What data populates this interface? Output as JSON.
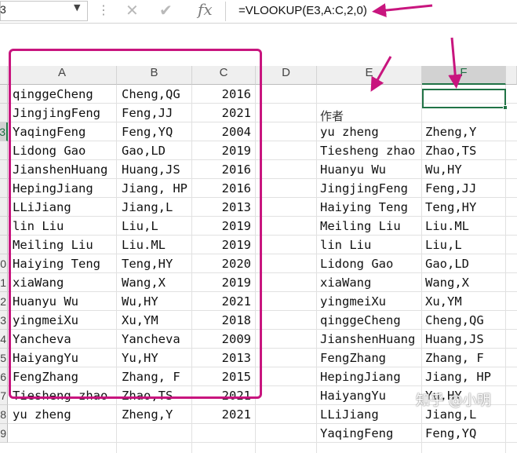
{
  "formula_bar": {
    "name_box": "3",
    "cancel_glyph": "✕",
    "enter_glyph": "✔",
    "fx_label": "fx",
    "formula": "=VLOOKUP(E3,A:C,2,0)"
  },
  "columns": [
    "A",
    "B",
    "C",
    "D",
    "E",
    "F"
  ],
  "selected_column": "F",
  "row_numbers": [
    "",
    "",
    "3",
    "",
    "",
    "",
    "",
    "",
    "",
    "0",
    "1",
    "2",
    "3",
    "4",
    "5",
    "6",
    "7",
    "8",
    "9"
  ],
  "selected_row": "3",
  "table_abc": [
    [
      "qinggeCheng",
      "Cheng,QG",
      "2016"
    ],
    [
      "JingjingFeng",
      "Feng,JJ",
      "2021"
    ],
    [
      "YaqingFeng",
      "Feng,YQ",
      "2004"
    ],
    [
      "Lidong Gao",
      "Gao,LD",
      "2019"
    ],
    [
      "JianshenHuang",
      "Huang,JS",
      "2016"
    ],
    [
      "HepingJiang",
      "Jiang, HP",
      "2016"
    ],
    [
      "LLiJiang",
      "Jiang,L",
      "2013"
    ],
    [
      "lin Liu",
      "Liu,L",
      "2019"
    ],
    [
      "Meiling Liu",
      "Liu.ML",
      "2019"
    ],
    [
      "Haiying Teng",
      "Teng,HY",
      "2020"
    ],
    [
      "xiaWang",
      "Wang,X",
      "2019"
    ],
    [
      "Huanyu Wu",
      "Wu,HY",
      "2021"
    ],
    [
      "yingmeiXu",
      "Xu,YM",
      "2018"
    ],
    [
      "Yancheva",
      "Yancheva",
      "2009"
    ],
    [
      "HaiyangYu",
      "Yu,HY",
      "2013"
    ],
    [
      "FengZhang",
      "Zhang, F",
      "2015"
    ],
    [
      "Tiesheng zhao",
      "Zhao,TS",
      "2021"
    ],
    [
      "yu zheng",
      "Zheng,Y",
      "2021"
    ]
  ],
  "header_e": "作者",
  "table_ef": [
    [
      "yu zheng",
      "Zheng,Y"
    ],
    [
      "Tiesheng zhao",
      "Zhao,TS"
    ],
    [
      "Huanyu Wu",
      "Wu,HY"
    ],
    [
      "JingjingFeng",
      "Feng,JJ"
    ],
    [
      "Haiying Teng",
      "Teng,HY"
    ],
    [
      "Meiling Liu",
      "Liu.ML"
    ],
    [
      "lin Liu",
      "Liu,L"
    ],
    [
      "Lidong Gao",
      "Gao,LD"
    ],
    [
      "xiaWang",
      "Wang,X"
    ],
    [
      "yingmeiXu",
      "Xu,YM"
    ],
    [
      "qinggeCheng",
      "Cheng,QG"
    ],
    [
      "JianshenHuang",
      "Huang,JS"
    ],
    [
      "FengZhang",
      "Zhang, F"
    ],
    [
      "HepingJiang",
      "Jiang, HP"
    ],
    [
      "HaiyangYu",
      "Yu,HY"
    ],
    [
      "LLiJiang",
      "Jiang,L"
    ],
    [
      "YaqingFeng",
      "Feng,YQ"
    ]
  ],
  "watermark": "知乎 @小明",
  "colors": {
    "annotation": "#c8157e",
    "selection": "#217346"
  }
}
